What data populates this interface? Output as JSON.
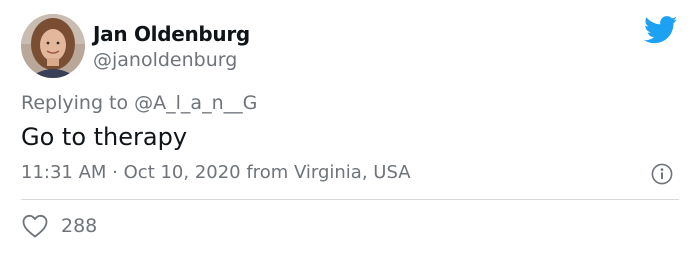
{
  "author": {
    "display_name": "Jan Oldenburg",
    "handle": "@janoldenburg",
    "avatar": "profile-photo"
  },
  "reply": {
    "prefix": "Replying to ",
    "mention": "@A_l_a_n__G"
  },
  "tweet": {
    "text": "Go to therapy"
  },
  "meta": {
    "time": "11:31 AM",
    "separator": " · ",
    "date": "Oct 10, 2020",
    "source_prefix": " from ",
    "location": "Virginia, USA"
  },
  "engagement": {
    "likes": "288"
  },
  "icons": {
    "brand": "twitter-bird-icon",
    "info": "info-icon",
    "like": "heart-icon"
  },
  "colors": {
    "twitter_blue": "#1da1f2",
    "text_primary": "#0f1419",
    "text_secondary": "#6e7479",
    "divider": "#d6dadd"
  }
}
